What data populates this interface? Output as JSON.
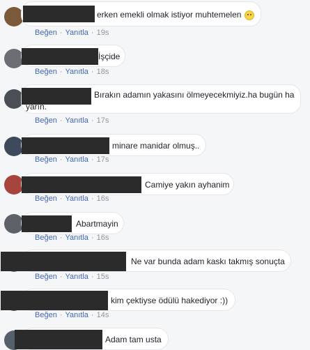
{
  "actions": {
    "like_label": "Beğen",
    "reply_label": "Yanıtla",
    "separator": "·"
  },
  "comments": [
    {
      "text": "erken emekli olmak istiyor muhtemelen",
      "time": "19s",
      "has_emoji": true,
      "emoji": "slight-smile-icon"
    },
    {
      "text": "İşçide",
      "time": "18s"
    },
    {
      "text": "Bırakın adamın yakasını ölmeyecekmiyiz.ha bugün ha yarın.",
      "time": "17s"
    },
    {
      "text": "minare manidar olmuş..",
      "time": "17s"
    },
    {
      "text": "Camiye yakın ayhanim",
      "time": "16s"
    },
    {
      "text": "Abartmayin",
      "time": "16s"
    },
    {
      "text": "Ne var bunda adam kaskı takmış sonuçta",
      "time": "15s"
    },
    {
      "text": "kim çektiyse ödülü hakediyor :))",
      "time": "14s"
    },
    {
      "text": "Adam tam usta",
      "time": ""
    }
  ]
}
